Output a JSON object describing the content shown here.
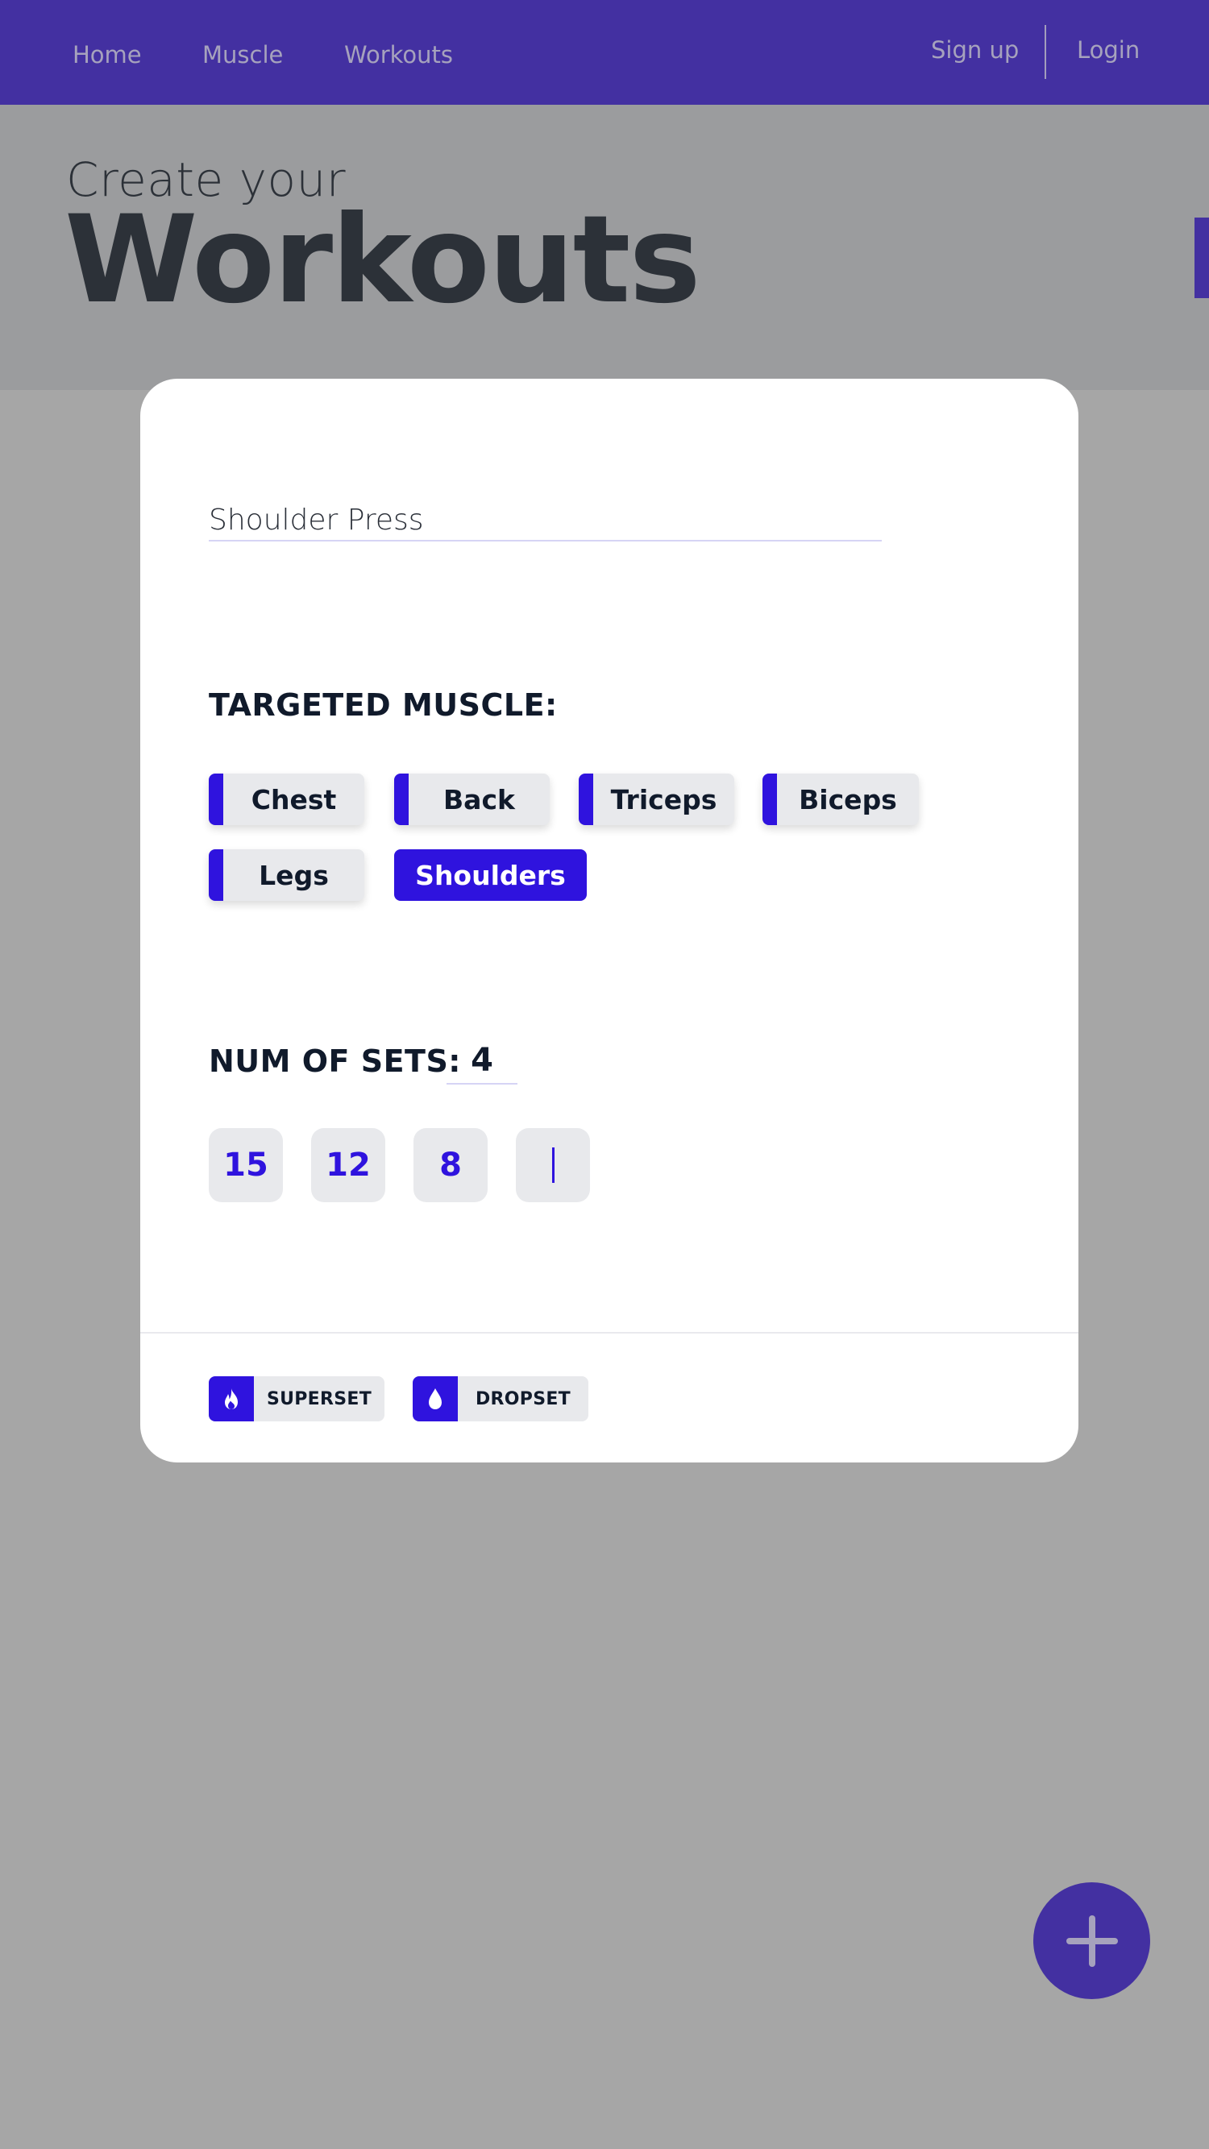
{
  "nav": {
    "links": [
      "Home",
      "Muscle",
      "Workouts"
    ],
    "signup": "Sign up",
    "login": "Login"
  },
  "hero": {
    "subtitle": "Create your",
    "title": "Workouts"
  },
  "form": {
    "exercise_name": "Shoulder Press",
    "muscle_label": "TARGETED MUSCLE:",
    "muscles": [
      {
        "label": "Chest",
        "selected": false
      },
      {
        "label": "Back",
        "selected": false
      },
      {
        "label": "Triceps",
        "selected": false
      },
      {
        "label": "Biceps",
        "selected": false
      },
      {
        "label": "Legs",
        "selected": false
      },
      {
        "label": "Shoulders",
        "selected": true
      }
    ],
    "sets_label": "NUM OF SETS:",
    "num_sets": "4",
    "reps": [
      "15",
      "12",
      "8",
      ""
    ],
    "tags": [
      {
        "label": "SUPERSET",
        "icon": "flame-icon"
      },
      {
        "label": "DROPSET",
        "icon": "drop-icon"
      }
    ]
  },
  "colors": {
    "accent": "#2f13de",
    "navbar": "#4330a1",
    "overlay": "#a6a6a6",
    "text_dark": "#101a2b"
  }
}
